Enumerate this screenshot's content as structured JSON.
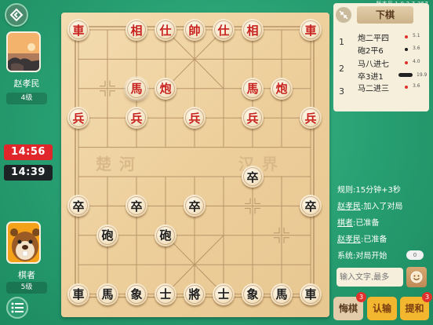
{
  "version": "版本号 1.0.2.7-357",
  "colors": {
    "timer_active": "#e0252b",
    "timer_idle": "#1d2225",
    "red_piece": "#c8221e",
    "black_piece": "#1d1d1d",
    "accent": "#f2b62f"
  },
  "top_player": {
    "name": "赵孝民",
    "level": "4级",
    "timer": "14:56"
  },
  "bottom_player": {
    "name": "棋者",
    "level": "5级",
    "timer": "14:39"
  },
  "board": {
    "river_left": "楚河",
    "river_right": "汉界",
    "pieces": [
      {
        "char": "車",
        "color": "red",
        "col": 0,
        "row": 0
      },
      {
        "char": "相",
        "color": "red",
        "col": 2,
        "row": 0
      },
      {
        "char": "仕",
        "color": "red",
        "col": 3,
        "row": 0
      },
      {
        "char": "帥",
        "color": "red",
        "col": 4,
        "row": 0
      },
      {
        "char": "仕",
        "color": "red",
        "col": 5,
        "row": 0
      },
      {
        "char": "相",
        "color": "red",
        "col": 6,
        "row": 0
      },
      {
        "char": "車",
        "color": "red",
        "col": 8,
        "row": 0
      },
      {
        "char": "馬",
        "color": "red",
        "col": 2,
        "row": 2,
        "selected": true
      },
      {
        "char": "炮",
        "color": "red",
        "col": 3,
        "row": 2
      },
      {
        "char": "馬",
        "color": "red",
        "col": 6,
        "row": 2
      },
      {
        "char": "炮",
        "color": "red",
        "col": 7,
        "row": 2
      },
      {
        "char": "兵",
        "color": "red",
        "col": 0,
        "row": 3
      },
      {
        "char": "兵",
        "color": "red",
        "col": 2,
        "row": 3
      },
      {
        "char": "兵",
        "color": "red",
        "col": 4,
        "row": 3
      },
      {
        "char": "兵",
        "color": "red",
        "col": 6,
        "row": 3
      },
      {
        "char": "兵",
        "color": "red",
        "col": 8,
        "row": 3
      },
      {
        "char": "卒",
        "color": "black",
        "col": 6,
        "row": 5
      },
      {
        "char": "卒",
        "color": "black",
        "col": 0,
        "row": 6
      },
      {
        "char": "卒",
        "color": "black",
        "col": 2,
        "row": 6
      },
      {
        "char": "卒",
        "color": "black",
        "col": 4,
        "row": 6
      },
      {
        "char": "卒",
        "color": "black",
        "col": 8,
        "row": 6
      },
      {
        "char": "砲",
        "color": "black",
        "col": 1,
        "row": 7
      },
      {
        "char": "砲",
        "color": "black",
        "col": 3,
        "row": 7
      },
      {
        "char": "車",
        "color": "black",
        "col": 0,
        "row": 9
      },
      {
        "char": "馬",
        "color": "black",
        "col": 1,
        "row": 9
      },
      {
        "char": "象",
        "color": "black",
        "col": 2,
        "row": 9
      },
      {
        "char": "士",
        "color": "black",
        "col": 3,
        "row": 9
      },
      {
        "char": "將",
        "color": "black",
        "col": 4,
        "row": 9
      },
      {
        "char": "士",
        "color": "black",
        "col": 5,
        "row": 9
      },
      {
        "char": "象",
        "color": "black",
        "col": 6,
        "row": 9
      },
      {
        "char": "馬",
        "color": "black",
        "col": 7,
        "row": 9
      },
      {
        "char": "車",
        "color": "black",
        "col": 8,
        "row": 9
      }
    ]
  },
  "panel": {
    "tab_title": "下棋",
    "moves": [
      {
        "num": "1",
        "text": "炮二平四",
        "dot": "red",
        "score": "5.1"
      },
      {
        "num": "",
        "text": "砲2平6",
        "dot": "black",
        "score": "3.6"
      },
      {
        "num": "2",
        "text": "马八进七",
        "dot": "red",
        "score": "4.0"
      },
      {
        "num": "",
        "text": "卒3进1",
        "dot": "bar",
        "score": "19.9"
      },
      {
        "num": "3",
        "text": "马二进三",
        "dot": "red",
        "score": "3.6"
      }
    ],
    "chat": [
      {
        "text": "规则:15分钟+3秒"
      },
      {
        "name": "赵孝民",
        "text": ":加入了对局"
      },
      {
        "name": "棋者",
        "text": ":已准备"
      },
      {
        "name": "赵孝民",
        "text": ":已准备"
      },
      {
        "text": "系统:对局开始"
      }
    ],
    "chat_toggle": "0",
    "chat_placeholder": "输入文字,最多",
    "actions": {
      "undo": "悔棋",
      "undo_badge": "3",
      "resign": "认输",
      "draw": "提和",
      "draw_badge": "3"
    }
  }
}
